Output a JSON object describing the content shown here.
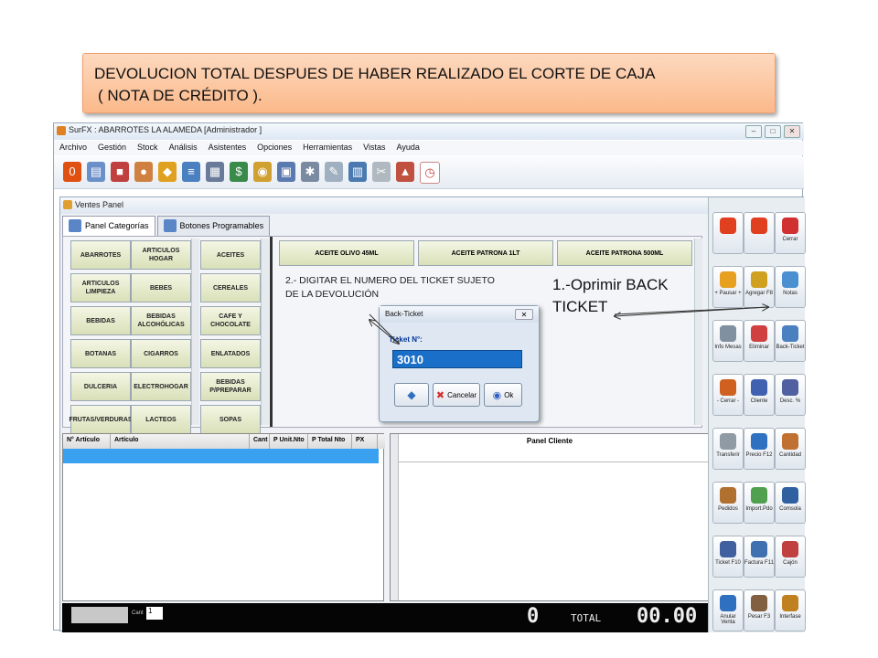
{
  "instruction": {
    "line1": "DEVOLUCION TOTAL DESPUES DE HABER REALIZADO EL CORTE DE CAJA",
    "line2": "( NOTA DE CRÉDITO )."
  },
  "app": {
    "title": "SurFX : ABARROTES LA ALAMEDA [Administrador ]",
    "menu": [
      "Archivo",
      "Gestión",
      "Stock",
      "Análisis",
      "Asistentes",
      "Opciones",
      "Herramientas",
      "Vistas",
      "Ayuda"
    ]
  },
  "ventes_panel": {
    "title": "Ventes Panel",
    "tabs": [
      "Panel Categorías",
      "Botones Programables"
    ],
    "categories_col1": [
      "ABARROTES",
      "ARTICULOS LIMPIEZA",
      "BEBIDAS",
      "BOTANAS",
      "DULCERIA",
      "FRUTAS/VERDURAS"
    ],
    "categories_col2": [
      "ARTICULOS HOGAR",
      "BEBES",
      "BEBIDAS ALCOHÓLICAS",
      "CIGARROS",
      "ELECTROHOGAR",
      "LACTEOS"
    ],
    "categories_col3": [
      "ACEITES",
      "CEREALES",
      "CAFE Y CHOCOLATE",
      "ENLATADOS",
      "BEBIDAS P/PREPARAR",
      "SOPAS"
    ],
    "products": [
      "ACEITE OLIVO 45ML",
      "ACEITE PATRONA 1LT",
      "ACEITE PATRONA 500ML"
    ],
    "grid_headers": [
      "N° Artículo",
      "Artículo",
      "Cant",
      "P Unit.Nto",
      "P Total Nto",
      "PX"
    ],
    "panel_cliente": "Panel Cliente",
    "cant_label": "Cant",
    "cant_value": "1",
    "count_display": "0",
    "total_label": "TOTAL",
    "total_value": "00.00"
  },
  "side_buttons": [
    {
      "label": "",
      "icon": "up-arrow-icon",
      "color": "#e04020"
    },
    {
      "label": "",
      "icon": "down-arrow-icon",
      "color": "#e04020"
    },
    {
      "label": "Cerrar",
      "icon": "close-icon",
      "color": "#d03030"
    },
    {
      "label": "+ Pausar +",
      "icon": "pause-icon",
      "color": "#e8a020"
    },
    {
      "label": "Agregar F8",
      "icon": "add-icon",
      "color": "#d0a020"
    },
    {
      "label": "Notas",
      "icon": "notes-icon",
      "color": "#4a90d0"
    },
    {
      "label": "Info Mesas",
      "icon": "info-icon",
      "color": "#8090a0"
    },
    {
      "label": "Eliminar",
      "icon": "delete-icon",
      "color": "#d04040"
    },
    {
      "label": "Back-Ticket",
      "icon": "back-ticket-icon",
      "color": "#4a80c0"
    },
    {
      "label": "- Cerrar -",
      "icon": "close-register-icon",
      "color": "#d06020"
    },
    {
      "label": "Cliente",
      "icon": "client-icon",
      "color": "#4060b0"
    },
    {
      "label": "Desc. %",
      "icon": "discount-icon",
      "color": "#5060a0"
    },
    {
      "label": "Transferir",
      "icon": "transfer-icon",
      "color": "#909aa4"
    },
    {
      "label": "Precio F12",
      "icon": "price-icon",
      "color": "#3070c0"
    },
    {
      "label": "Cantidad",
      "icon": "quantity-icon",
      "color": "#c07030"
    },
    {
      "label": "Pedidos",
      "icon": "orders-icon",
      "color": "#b07030"
    },
    {
      "label": "Import.Pdo",
      "icon": "import-icon",
      "color": "#50a050"
    },
    {
      "label": "Comsola",
      "icon": "console-icon",
      "color": "#3060a0"
    },
    {
      "label": "Ticket F10",
      "icon": "ticket-icon",
      "color": "#4060a0"
    },
    {
      "label": "Factura F11",
      "icon": "invoice-icon",
      "color": "#4070b0"
    },
    {
      "label": "Cajón",
      "icon": "drawer-icon",
      "color": "#c04040"
    },
    {
      "label": "Anular Venta",
      "icon": "cancel-sale-icon",
      "color": "#3070c0"
    },
    {
      "label": "Pesar F3",
      "icon": "scale-icon",
      "color": "#806040"
    },
    {
      "label": "Interfase",
      "icon": "interface-icon",
      "color": "#c08020"
    }
  ],
  "dialog": {
    "title": "Back-Ticket",
    "label": "Ticket N°:",
    "value": "3010",
    "cancel": "Cancelar",
    "ok": "Ok"
  },
  "notes": {
    "step2": "2.- DIGITAR EL NUMERO DEL TICKET SUJETO DE LA DEVOLUCIÓN",
    "step1_line1": "1.-Oprimir BACK",
    "step1_line2": "TICKET"
  }
}
